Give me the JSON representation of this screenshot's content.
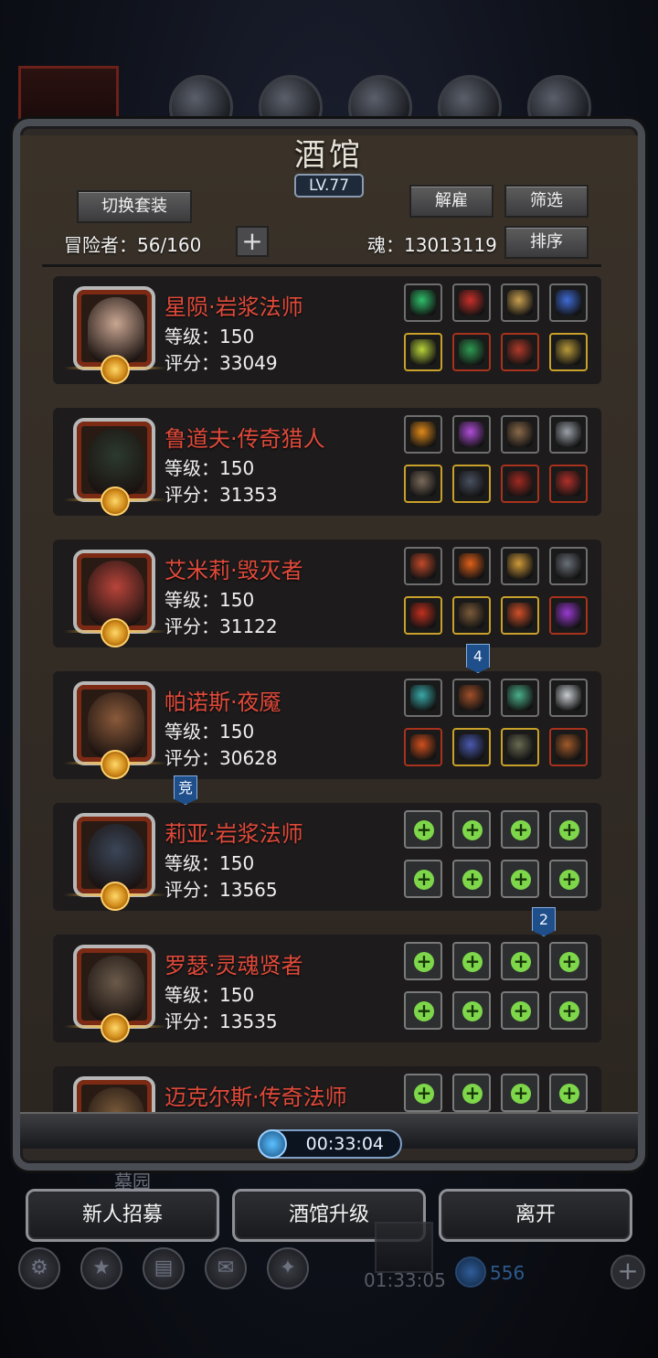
{
  "window": {
    "title": "酒馆",
    "level": "LV.77"
  },
  "toolbar": {
    "switch_outfit_label": "切换套装",
    "dismiss_label": "解雇",
    "filter_label": "筛选",
    "sort_label": "排序",
    "adventurers_label": "冒险者：56/160",
    "add_label": "+",
    "soul_label": "魂：13013119"
  },
  "heroes": [
    {
      "name": "星陨·岩浆法师",
      "level": "等级：150",
      "score": "评分：33049",
      "portrait_color": "#c9a692",
      "slots": [
        {
          "icon": "green-orb-icon",
          "color": "#2fbf6a",
          "frame": "plain"
        },
        {
          "icon": "red-ring-icon",
          "color": "#c8302a",
          "frame": "plain"
        },
        {
          "icon": "gold-armor-icon",
          "color": "#c9a050",
          "frame": "plain"
        },
        {
          "icon": "lantern-icon",
          "color": "#3f6bd6",
          "frame": "plain"
        },
        {
          "icon": "staff-icon",
          "color": "#b7d43a",
          "frame": "gold"
        },
        {
          "icon": "green-chest-icon",
          "color": "#2f9a52",
          "frame": "red"
        },
        {
          "icon": "demon-mask-icon",
          "color": "#b03a2a",
          "frame": "red"
        },
        {
          "icon": "gold-ring-icon",
          "color": "#b89a3a",
          "frame": "gold"
        }
      ]
    },
    {
      "name": "鲁道夫·传奇猎人",
      "level": "等级：150",
      "score": "评分：31353",
      "portrait_color": "#2c3a2e",
      "slots": [
        {
          "icon": "fire-ring-icon",
          "color": "#e08a1a",
          "frame": "plain"
        },
        {
          "icon": "purple-gem-icon",
          "color": "#b04ed8",
          "frame": "plain"
        },
        {
          "icon": "pickaxe-icon",
          "color": "#8a6a4a",
          "frame": "plain"
        },
        {
          "icon": "silver-emblem-icon",
          "color": "#9aa0a8",
          "frame": "plain"
        },
        {
          "icon": "pistol-icon",
          "color": "#7a6a5a",
          "frame": "gold"
        },
        {
          "icon": "dark-armor-icon",
          "color": "#4a5060",
          "frame": "gold"
        },
        {
          "icon": "red-helm-icon",
          "color": "#a02a22",
          "frame": "red"
        },
        {
          "icon": "crimson-boots-icon",
          "color": "#b0302a",
          "frame": "red"
        }
      ]
    },
    {
      "name": "艾米莉·毁灭者",
      "level": "等级：150",
      "score": "评分：31122",
      "portrait_color": "#b8443a",
      "slots": [
        {
          "icon": "flame-crown-icon",
          "color": "#c04a2a",
          "frame": "plain"
        },
        {
          "icon": "fire-orb-icon",
          "color": "#e0601a",
          "frame": "plain"
        },
        {
          "icon": "lamp-icon",
          "color": "#d09a3a",
          "frame": "plain"
        },
        {
          "icon": "stone-icon",
          "color": "#6a7078",
          "frame": "plain"
        },
        {
          "icon": "red-axe-icon",
          "color": "#c0301e",
          "frame": "gold"
        },
        {
          "icon": "bronze-armor-icon",
          "color": "#7a5a3a",
          "frame": "gold"
        },
        {
          "icon": "ruby-ring-icon",
          "color": "#d0502a",
          "frame": "gold"
        },
        {
          "icon": "violet-crystal-icon",
          "color": "#9a3ad0",
          "frame": "red"
        }
      ]
    },
    {
      "name": "帕诺斯·夜魇",
      "level": "等级：150",
      "score": "评分：30628",
      "portrait_color": "#8a5a3a",
      "slots": [
        {
          "icon": "teal-amulet-icon",
          "color": "#3aa8a8",
          "frame": "plain"
        },
        {
          "icon": "ore-icon",
          "color": "#a0502a",
          "frame": "plain"
        },
        {
          "icon": "scythe-icon",
          "color": "#4ab08a",
          "frame": "plain"
        },
        {
          "icon": "white-stone-icon",
          "color": "#c8ccd0",
          "frame": "plain"
        },
        {
          "icon": "fire-spear-icon",
          "color": "#d0501e",
          "frame": "red"
        },
        {
          "icon": "blue-plate-icon",
          "color": "#4a5ab0",
          "frame": "gold"
        },
        {
          "icon": "bone-helm-icon",
          "color": "#6a6a52",
          "frame": "gold"
        },
        {
          "icon": "copper-mace-icon",
          "color": "#a05a2a",
          "frame": "red"
        }
      ]
    },
    {
      "name": "莉亚·岩浆法师",
      "level": "等级：150",
      "score": "评分：13565",
      "portrait_color": "#3a4658",
      "slots": [
        {
          "icon": "empty-slot-icon",
          "color": "#7ed64a",
          "frame": "empty"
        },
        {
          "icon": "empty-slot-icon",
          "color": "#7ed64a",
          "frame": "empty"
        },
        {
          "icon": "empty-slot-icon",
          "color": "#7ed64a",
          "frame": "empty"
        },
        {
          "icon": "empty-slot-icon",
          "color": "#7ed64a",
          "frame": "empty"
        },
        {
          "icon": "empty-slot-icon",
          "color": "#7ed64a",
          "frame": "empty"
        },
        {
          "icon": "empty-slot-icon",
          "color": "#7ed64a",
          "frame": "empty"
        },
        {
          "icon": "empty-slot-icon",
          "color": "#7ed64a",
          "frame": "empty"
        },
        {
          "icon": "empty-slot-icon",
          "color": "#7ed64a",
          "frame": "empty"
        }
      ]
    },
    {
      "name": "罗瑟·灵魂贤者",
      "level": "等级：150",
      "score": "评分：13535",
      "portrait_color": "#6a5a4a",
      "slots": [
        {
          "icon": "empty-slot-icon",
          "color": "#7ed64a",
          "frame": "empty"
        },
        {
          "icon": "empty-slot-icon",
          "color": "#7ed64a",
          "frame": "empty"
        },
        {
          "icon": "empty-slot-icon",
          "color": "#7ed64a",
          "frame": "empty"
        },
        {
          "icon": "empty-slot-icon",
          "color": "#7ed64a",
          "frame": "empty"
        },
        {
          "icon": "empty-slot-icon",
          "color": "#7ed64a",
          "frame": "empty"
        },
        {
          "icon": "empty-slot-icon",
          "color": "#7ed64a",
          "frame": "empty"
        },
        {
          "icon": "empty-slot-icon",
          "color": "#7ed64a",
          "frame": "empty"
        },
        {
          "icon": "empty-slot-icon",
          "color": "#7ed64a",
          "frame": "empty"
        }
      ]
    },
    {
      "name": "迈克尔斯·传奇法师",
      "level": "",
      "score": "",
      "portrait_color": "#7a5a3a",
      "slots": [
        {
          "icon": "empty-slot-icon",
          "color": "#7ed64a",
          "frame": "empty"
        },
        {
          "icon": "empty-slot-icon",
          "color": "#7ed64a",
          "frame": "empty"
        },
        {
          "icon": "empty-slot-icon",
          "color": "#7ed64a",
          "frame": "empty"
        },
        {
          "icon": "empty-slot-icon",
          "color": "#7ed64a",
          "frame": "empty"
        }
      ]
    }
  ],
  "markers": {
    "tag_4": "4",
    "tag_arena": "竞",
    "tag_2": "2"
  },
  "footer": {
    "timer": "00:33:04",
    "graveyard": "墓园",
    "recruit_label": "新人招募",
    "upgrade_label": "酒馆升级",
    "leave_label": "离开",
    "bg_timer": "01:33:05",
    "bg_coins": "556"
  },
  "colors": {
    "hero_name": "#e04a3a",
    "accent_tag": "#1f4f8a",
    "empty_slot_plus": "#7ed64a"
  }
}
